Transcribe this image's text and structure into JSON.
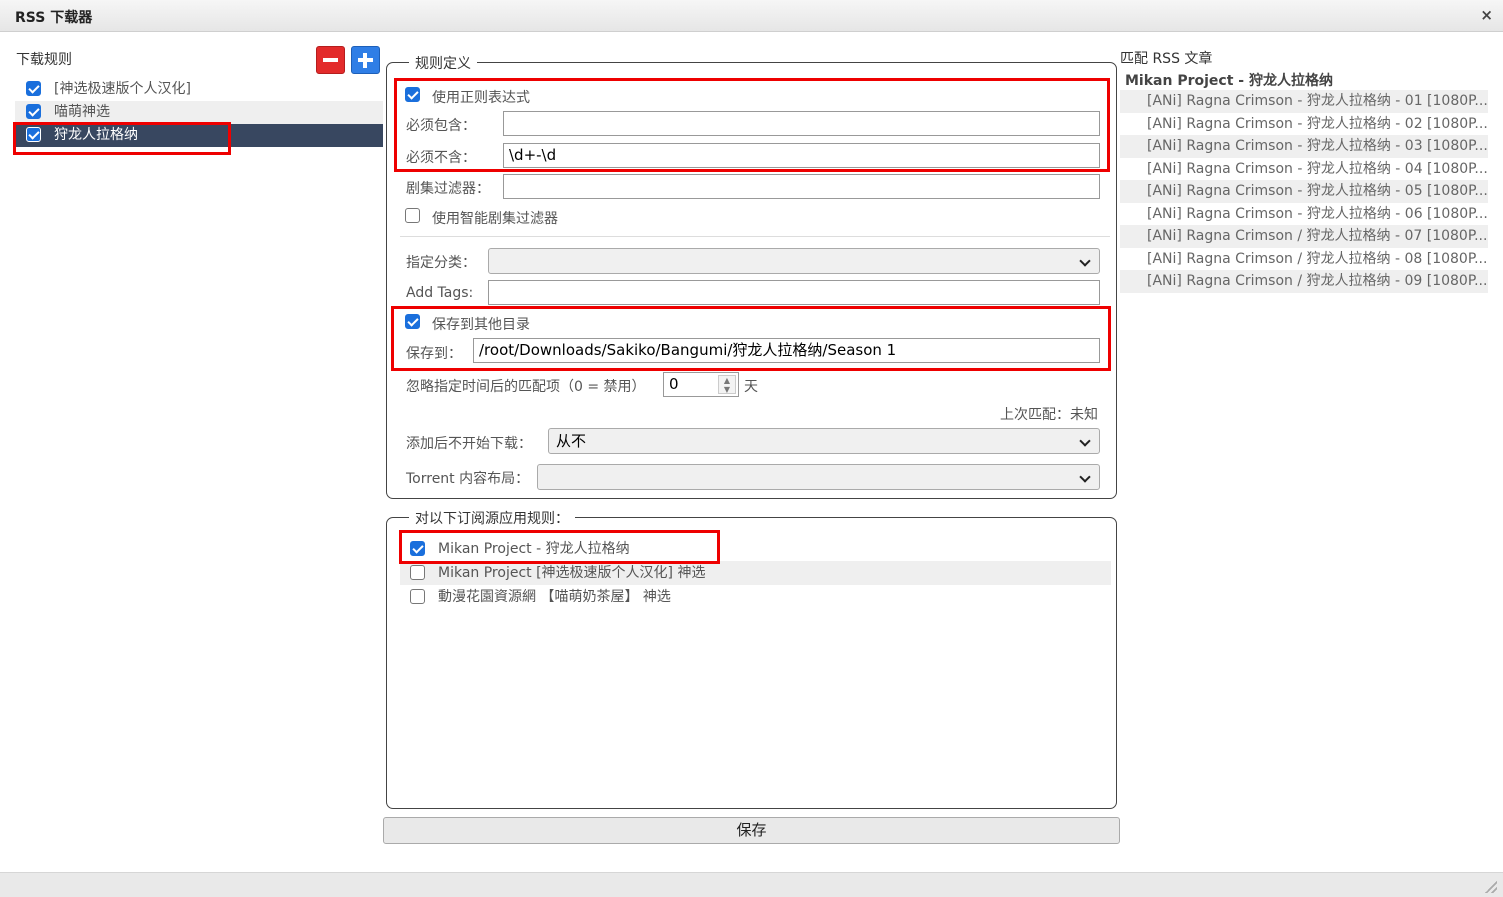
{
  "window": {
    "title": "RSS 下载器",
    "close_glyph": "×"
  },
  "left": {
    "title": "下载规则",
    "rules": [
      {
        "label": "[神选极速版个人汉化]",
        "checked": true
      },
      {
        "label": "喵萌神选",
        "checked": true
      },
      {
        "label": "狩龙人拉格纳",
        "checked": true,
        "selected": true
      }
    ]
  },
  "rule_def": {
    "legend": "规则定义",
    "use_regex_label": "使用正则表达式",
    "must_contain_label": "必须包含：",
    "must_contain_value": "",
    "must_not_contain_label": "必须不含：",
    "must_not_contain_value": "\\d+-\\d",
    "episode_filter_label": "剧集过滤器：",
    "episode_filter_value": "",
    "smart_filter_label": "使用智能剧集过滤器",
    "category_label": "指定分类：",
    "category_value": "",
    "tags_label": "Add Tags:",
    "tags_value": "",
    "save_other_label": "保存到其他目录",
    "save_to_label": "保存到：",
    "save_to_value": "/root/Downloads/Sakiko/Bangumi/狩龙人拉格纳/Season 1",
    "ignore_label": "忽略指定时间后的匹配项（0 = 禁用）",
    "ignore_value": "0",
    "ignore_unit": "天",
    "last_match": "上次匹配：未知",
    "add_paused_label": "添加后不开始下载：",
    "add_paused_value": "从不",
    "layout_label": "Torrent 内容布局：",
    "layout_value": ""
  },
  "feeds": {
    "legend": "对以下订阅源应用规则：",
    "items": [
      {
        "label": "Mikan Project - 狩龙人拉格纳",
        "checked": true
      },
      {
        "label": "Mikan Project [神选极速版个人汉化] 神选",
        "checked": false
      },
      {
        "label": "動漫花園資源網 【喵萌奶茶屋】 神选",
        "checked": false
      }
    ]
  },
  "save_button": "保存",
  "right": {
    "title": "匹配 RSS 文章",
    "feed_name": "Mikan Project - 狩龙人拉格纳",
    "articles": [
      "[ANi] Ragna Crimson - 狩龙人拉格纳 - 01 [1080P...",
      "[ANi] Ragna Crimson - 狩龙人拉格纳 - 02 [1080P...",
      "[ANi] Ragna Crimson - 狩龙人拉格纳 - 03 [1080P...",
      "[ANi] Ragna Crimson - 狩龙人拉格纳 - 04 [1080P...",
      "[ANi] Ragna Crimson - 狩龙人拉格纳 - 05 [1080P...",
      "[ANi] Ragna Crimson - 狩龙人拉格纳 - 06 [1080P...",
      "[ANi] Ragna Crimson / 狩龙人拉格纳 - 07 [1080P...",
      "[ANi] Ragna Crimson / 狩龙人拉格纳 - 08 [1080P...",
      "[ANi] Ragna Crimson / 狩龙人拉格纳 - 09 [1080P..."
    ]
  },
  "colors": {
    "accent": "#1a6fdc",
    "selected_row": "#384760",
    "highlight": "#ee0000"
  }
}
